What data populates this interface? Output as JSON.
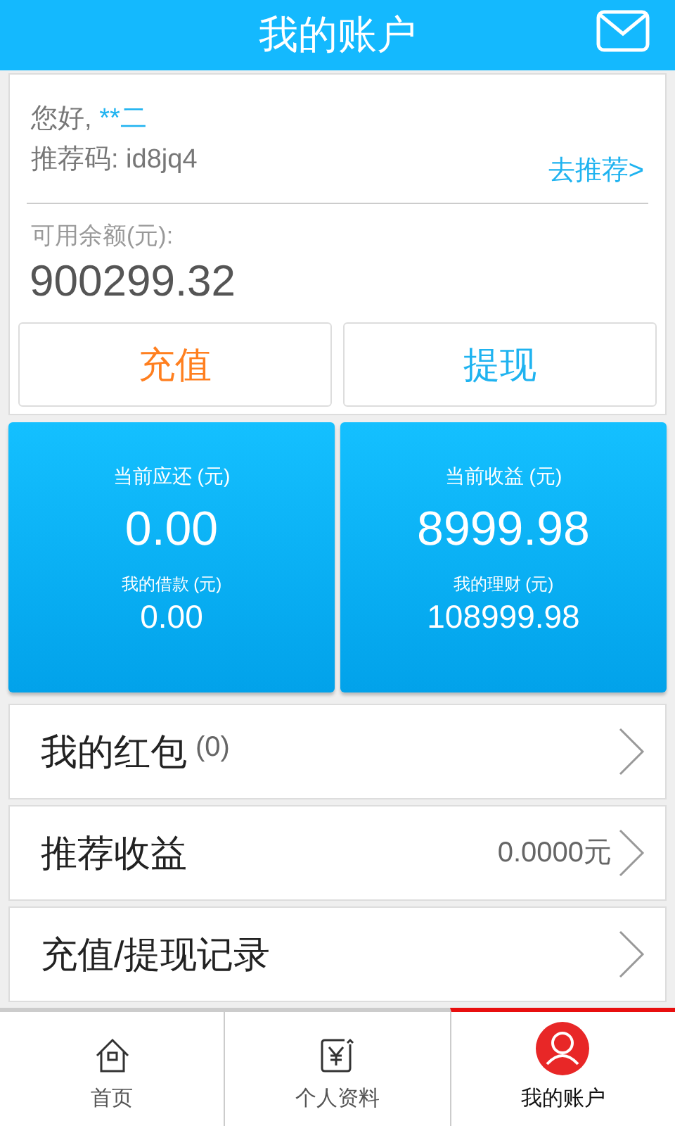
{
  "header": {
    "title": "我的账户"
  },
  "account": {
    "greeting": "您好,",
    "user_name": "**二",
    "referral_code": "推荐码: id8jq4",
    "recommend_link": "去推荐>",
    "balance_label": "可用余额(元):",
    "balance": "900299.32"
  },
  "actions": [
    {
      "label": "充值",
      "color": "#ff7f1f"
    },
    {
      "label": "提现",
      "color": "#1fb3f0"
    }
  ],
  "stats": [
    {
      "label": "当前应还 (元)",
      "value": "0.00",
      "sub_label": "我的借款 (元)",
      "sub_value": "0.00"
    },
    {
      "label": "当前收益 (元)",
      "value": "8999.98",
      "sub_label": "我的理财 (元)",
      "sub_value": "108999.98"
    }
  ],
  "menu": [
    {
      "label": "我的红包",
      "count": "(0)"
    },
    {
      "label": "推荐收益",
      "value": "0.0000元"
    },
    {
      "label": "充值/提现记录"
    }
  ],
  "tabs": [
    {
      "label": "首页",
      "kind": "home",
      "selected": false
    },
    {
      "label": "个人资料",
      "kind": "profile",
      "selected": false
    },
    {
      "label": "我的账户",
      "kind": "account",
      "selected": true
    }
  ]
}
